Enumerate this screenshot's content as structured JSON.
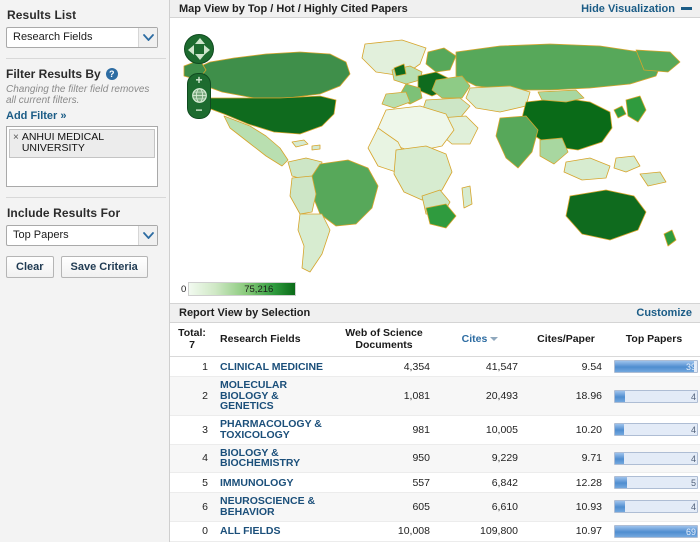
{
  "sidebar": {
    "results_list_label": "Results List",
    "results_list_value": "Research Fields",
    "filter_title": "Filter Results By",
    "help_glyph": "?",
    "filter_note": "Changing the filter field removes all current filters.",
    "add_filter_label": "Add Filter »",
    "filter_chip_x": "×",
    "filter_chip_label": "ANHUI MEDICAL UNIVERSITY",
    "include_label": "Include Results For",
    "include_value": "Top Papers",
    "clear_label": "Clear",
    "save_label": "Save Criteria"
  },
  "map_panel": {
    "title": "Map View by Top / Hot / Highly Cited Papers",
    "hide_label": "Hide Visualization",
    "legend_min": "0",
    "legend_max": "75,216",
    "zoom_in_glyph": "+",
    "zoom_out_glyph": "−"
  },
  "report": {
    "title": "Report View by Selection",
    "customize_label": "Customize",
    "total_label": "Total:",
    "total_value": "7",
    "columns": {
      "field": "Research Fields",
      "documents": "Web of Science Documents",
      "documents_l1": "Web of Science",
      "documents_l2": "Documents",
      "cites": "Cites",
      "cites_per_paper": "Cites/Paper",
      "top_papers": "Top Papers"
    },
    "rows": [
      {
        "rank": "1",
        "field": "CLINICAL MEDICINE",
        "documents": "4,354",
        "cites": "41,547",
        "cites_per_paper": "9.54",
        "top_papers": "39",
        "bar_pct": 96
      },
      {
        "rank": "2",
        "field": "MOLECULAR BIOLOGY & GENETICS",
        "documents": "1,081",
        "cites": "20,493",
        "cites_per_paper": "18.96",
        "top_papers": "4",
        "bar_pct": 12
      },
      {
        "rank": "3",
        "field": "PHARMACOLOGY & TOXICOLOGY",
        "documents": "981",
        "cites": "10,005",
        "cites_per_paper": "10.20",
        "top_papers": "4",
        "bar_pct": 11
      },
      {
        "rank": "4",
        "field": "BIOLOGY & BIOCHEMISTRY",
        "documents": "950",
        "cites": "9,229",
        "cites_per_paper": "9.71",
        "top_papers": "4",
        "bar_pct": 11
      },
      {
        "rank": "5",
        "field": "IMMUNOLOGY",
        "documents": "557",
        "cites": "6,842",
        "cites_per_paper": "12.28",
        "top_papers": "5",
        "bar_pct": 15
      },
      {
        "rank": "6",
        "field": "NEUROSCIENCE & BEHAVIOR",
        "documents": "605",
        "cites": "6,610",
        "cites_per_paper": "10.93",
        "top_papers": "4",
        "bar_pct": 12
      },
      {
        "rank": "0",
        "field": "ALL FIELDS",
        "documents": "10,008",
        "cites": "109,800",
        "cites_per_paper": "10.97",
        "top_papers": "69",
        "bar_pct": 100
      }
    ]
  },
  "colors": {
    "link_blue": "#1b5c86",
    "field_blue": "#1b4f7a",
    "bar_blue": "#4f8dd0",
    "map_green_dark": "#0a6b18",
    "map_green_mid": "#57a85a",
    "map_border": "#d6a42b",
    "nav_green": "#1d6b2f"
  }
}
